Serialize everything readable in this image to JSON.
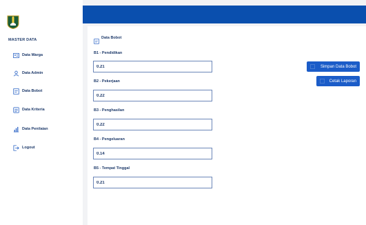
{
  "sidebar": {
    "section_title": "MASTER DATA",
    "items": [
      {
        "label": "Data Warga",
        "icon": "id-card-icon"
      },
      {
        "label": "Data Admin",
        "icon": "user-icon"
      },
      {
        "label": "Data Bobot",
        "icon": "scale-icon"
      },
      {
        "label": "Data Kriteria",
        "icon": "list-icon"
      },
      {
        "label": "Data Penilaian",
        "icon": "chart-icon"
      },
      {
        "label": "Logout",
        "icon": "logout-icon"
      }
    ]
  },
  "main": {
    "title": "Data Bobot",
    "fields": [
      {
        "label": "B1 - Pendidikan",
        "value": "0.21"
      },
      {
        "label": "B2 - Pekerjaan",
        "value": "0.22"
      },
      {
        "label": "B3 - Penghasilan",
        "value": "0.22"
      },
      {
        "label": "B4 - Pengeluaran",
        "value": "0.14"
      },
      {
        "label": "B5 - Tempat Tinggal",
        "value": "0.21"
      }
    ]
  },
  "actions": {
    "save_label": "Simpan Data Bobot",
    "print_label": "Cetak Laporan"
  },
  "colors": {
    "header": "#0a4fae",
    "button": "#1b5cc8",
    "text": "#1f3b6b",
    "background": "#f2f3f5"
  }
}
